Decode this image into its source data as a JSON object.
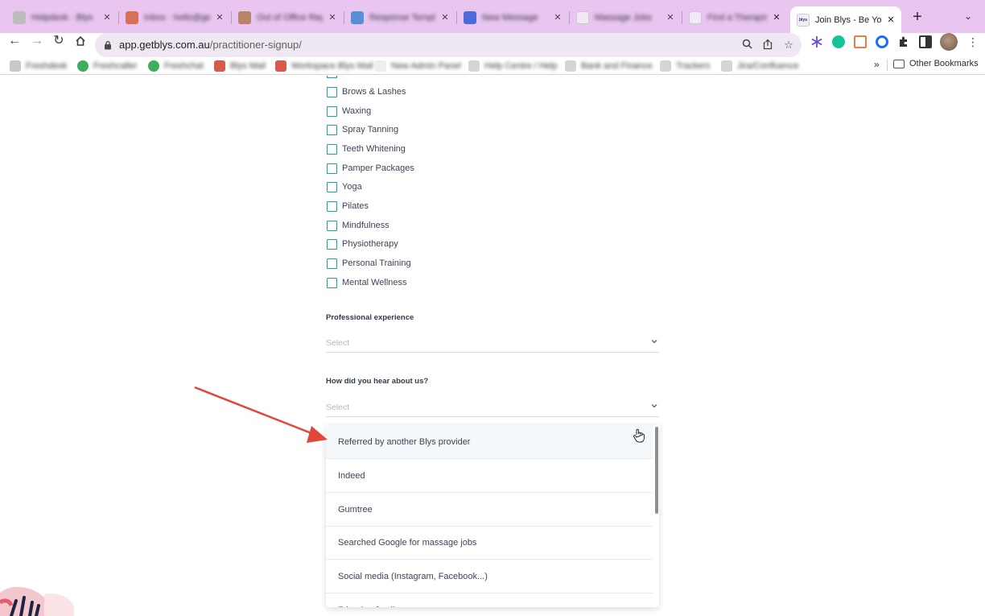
{
  "browser": {
    "tabs": [
      {
        "title": "Helpdesk · Blys"
      },
      {
        "title": "Inbox · hello@getblys"
      },
      {
        "title": "Out of Office Reply"
      },
      {
        "title": "Response Template"
      },
      {
        "title": "New Message"
      },
      {
        "title": "Massage Jobs"
      },
      {
        "title": "Find a Therapist"
      },
      {
        "title": "Join Blys - Be Your Own Boss"
      }
    ],
    "active_tab_index": 7,
    "active_tab_title": "Join Blys - Be Yo",
    "url_domain": "app.getblys.com.au",
    "url_path": "/practitioner-signup/",
    "bookmarks": [
      {
        "label": "Freshdesk"
      },
      {
        "label": "Freshcaller"
      },
      {
        "label": "Freshchat"
      },
      {
        "label": "Blys Mail"
      },
      {
        "label": "Workspace Blys Mail"
      },
      {
        "label": "New Admin Panel"
      },
      {
        "label": "Help Centre / Help"
      },
      {
        "label": "Bank and Finance"
      },
      {
        "label": "Trackers"
      },
      {
        "label": "Jira/Confluence"
      }
    ],
    "other_bookmarks_label": "Other Bookmarks",
    "overflow_label": "»"
  },
  "services": [
    {
      "label": "Brows & Lashes"
    },
    {
      "label": "Waxing"
    },
    {
      "label": "Spray Tanning"
    },
    {
      "label": "Teeth Whitening"
    },
    {
      "label": "Pamper Packages"
    },
    {
      "label": "Yoga"
    },
    {
      "label": "Pilates"
    },
    {
      "label": "Mindfulness"
    },
    {
      "label": "Physiotherapy"
    },
    {
      "label": "Personal Training"
    },
    {
      "label": "Mental Wellness"
    }
  ],
  "professional_experience": {
    "label": "Professional experience",
    "placeholder": "Select"
  },
  "hear_about_us": {
    "label": "How did you hear about us?",
    "placeholder": "Select",
    "options": [
      {
        "label": "Referred by another Blys provider"
      },
      {
        "label": "Indeed"
      },
      {
        "label": "Gumtree"
      },
      {
        "label": "Searched Google for massage jobs"
      },
      {
        "label": "Social media (Instagram, Facebook...)"
      },
      {
        "label": "Friend or family"
      }
    ]
  },
  "colors": {
    "tabbar": "#e8c6f0",
    "checkbox_border": "#1aa3a8",
    "annotation_arrow": "#e0463c"
  }
}
